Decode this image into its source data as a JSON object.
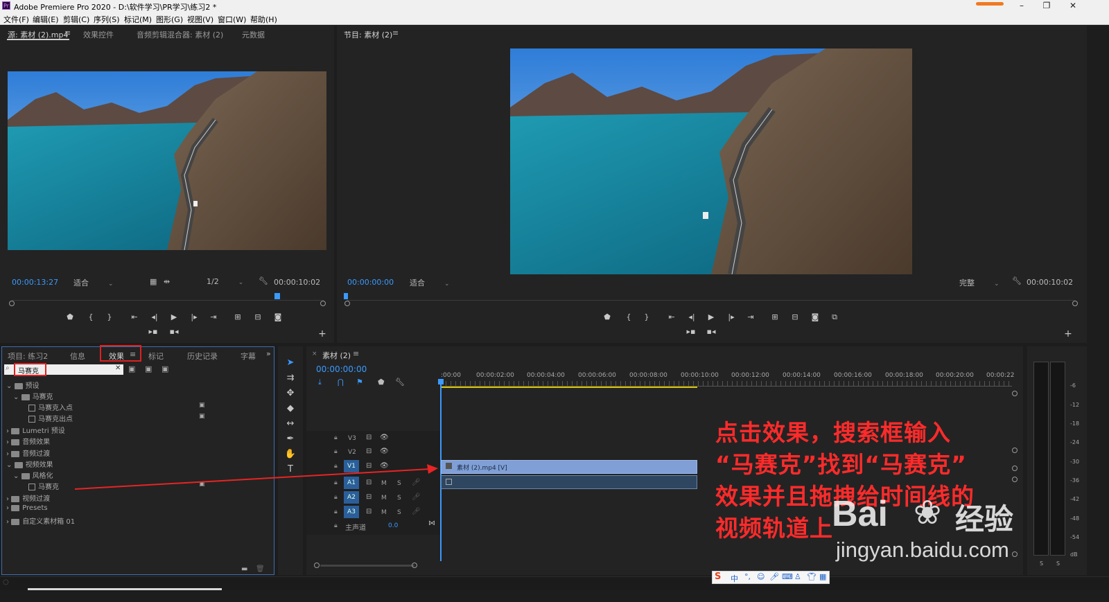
{
  "window": {
    "title": "Adobe Premiere Pro 2020 - D:\\软件学习\\PR学习\\练习2 *",
    "app_icon": "Pr"
  },
  "menu": [
    "文件(F)",
    "编辑(E)",
    "剪辑(C)",
    "序列(S)",
    "标记(M)",
    "图形(G)",
    "视图(V)",
    "窗口(W)",
    "帮助(H)"
  ],
  "source_panel": {
    "tabs": [
      "源: 素材 (2).mp4",
      "效果控件",
      "音频剪辑混合器: 素材 (2)",
      "元数据"
    ],
    "current_time": "00:00:13:27",
    "fit": "适合",
    "resolution": "1/2",
    "duration": "00:00:10:02"
  },
  "program_panel": {
    "tab": "节目: 素材 (2)",
    "current_time": "00:00:00:00",
    "fit": "适合",
    "quality": "完整",
    "duration": "00:00:10:02"
  },
  "project_panel": {
    "tabs": [
      "项目: 练习2",
      "信息",
      "效果",
      "标记",
      "历史记录",
      "字幕"
    ],
    "active_tab": "效果",
    "search_value": "马赛克",
    "tree": [
      "预设",
      "马赛克",
      "马赛克入点",
      "马赛克出点",
      "Lumetri 预设",
      "音频效果",
      "音频过渡",
      "视频效果",
      "风格化",
      "马赛克",
      "视频过渡",
      "Presets",
      "自定义素材箱 01"
    ]
  },
  "timeline": {
    "tab": "素材 (2)",
    "current_time": "00:00:00:00",
    "ruler": [
      ":00:00",
      "00:00:02:00",
      "00:00:04:00",
      "00:00:06:00",
      "00:00:08:00",
      "00:00:10:00",
      "00:00:12:00",
      "00:00:14:00",
      "00:00:16:00",
      "00:00:18:00",
      "00:00:20:00",
      "00:00:22"
    ],
    "tracks": [
      "V3",
      "V2",
      "V1",
      "A1",
      "A2",
      "A3"
    ],
    "master": "主声道",
    "master_value": "0.0",
    "clip_label": "素材 (2).mp4 [V]",
    "mute": "M",
    "solo": "S"
  },
  "meter": {
    "scale": [
      "-6",
      "-12",
      "-18",
      "-24",
      "-30",
      "-36",
      "-42",
      "-48",
      "-54",
      "dB"
    ],
    "solo_buttons": [
      "S",
      "S"
    ]
  },
  "annotation": {
    "lines": [
      "点击效果，搜索框输入",
      "“马赛克”找到“马赛克”",
      "效果并且拖拽给时间线的",
      "视频轨道上"
    ],
    "color": "#ff2b2b"
  },
  "watermark": {
    "brand": "Bai",
    "brand_cn": "经验",
    "url": "jingyan.baidu.com"
  },
  "ime_bar": {
    "label": "中"
  }
}
